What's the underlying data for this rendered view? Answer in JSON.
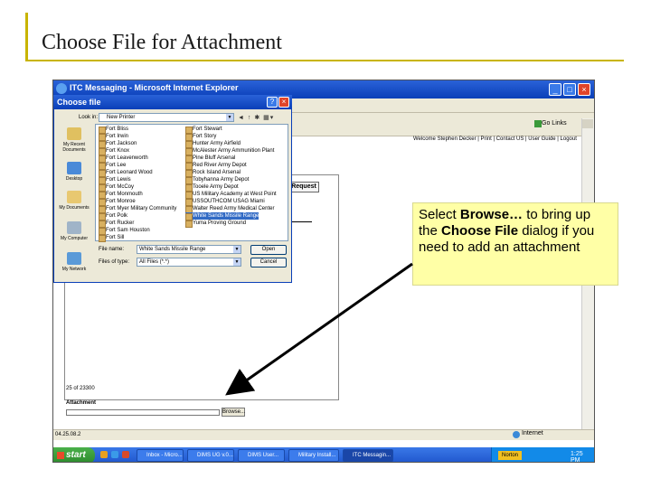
{
  "slide": {
    "title": "Choose File for Attachment"
  },
  "browser": {
    "window_title": "ITC Messaging - Microsoft Internet Explorer",
    "go_label": "Go",
    "links_label": "Links",
    "welcome_text": "Welcome Stephen Decker | Print | Contact US | User Guide | Logout",
    "request_button": "Request",
    "page_info": "25 of 23300",
    "attachment_label": "Attachment",
    "browse_button": "Browse...",
    "status_text": "04.25.08.2",
    "zone_text": "Internet"
  },
  "dialog": {
    "title": "Choose file",
    "lookin_label": "Look in:",
    "lookin_value": "New Printer",
    "places": [
      {
        "label": "My Recent Documents"
      },
      {
        "label": "Desktop"
      },
      {
        "label": "My Documents"
      },
      {
        "label": "My Computer"
      },
      {
        "label": "My Network"
      }
    ],
    "files_col1": [
      "Fort Bliss",
      "Fort Irwin",
      "Fort Jackson",
      "Fort Knox",
      "Fort Leavenworth",
      "Fort Lee",
      "Fort Leonard Wood",
      "Fort Lewis",
      "Fort McCoy",
      "Fort Monmouth",
      "Fort Monroe",
      "Fort Myer Military Community",
      "Fort Polk",
      "Fort Rucker",
      "Fort Sam Houston",
      "Fort Sill"
    ],
    "files_col2": [
      "Fort Stewart",
      "Fort Story",
      "Hunter Army Airfield",
      "McAlester Army Ammunition Plant",
      "Pine Bluff Arsenal",
      "Red River Army Depot",
      "Rock Island Arsenal",
      "Tobyhanna Army Depot",
      "Tooele Army Depot",
      "US Military Academy at West Point",
      "USSOUTHCOM USAG Miami",
      "Walter Reed Army Medical Center",
      "White Sands Missile Range",
      "Yuma Proving Ground"
    ],
    "selected_file": "White Sands Missile Range",
    "filename_label": "File name:",
    "filename_value": "White Sands Missile Range",
    "filetype_label": "Files of type:",
    "filetype_value": "All Files (*.*)",
    "open_button": "Open",
    "cancel_button": "Cancel"
  },
  "taskbar": {
    "start_label": "start",
    "items": [
      {
        "label": "Inbox - Micro..."
      },
      {
        "label": "DIMS UG v.0..."
      },
      {
        "label": "DIMS User..."
      },
      {
        "label": "Military Install..."
      },
      {
        "label": "ITC Messagin..."
      }
    ],
    "norton_label": "Norton",
    "clock": "1:25 PM"
  },
  "callout": {
    "text_before": "Select ",
    "bold1": "Browse…",
    "text_mid": " to bring up the ",
    "bold2": "Choose File",
    "text_after": " dialog if you need to add an attachment"
  },
  "colors": {
    "accent_bar": "#c8b400",
    "callout_bg": "#ffffa6",
    "xp_blue": "#0a3fb8",
    "selection": "#316ac5"
  }
}
